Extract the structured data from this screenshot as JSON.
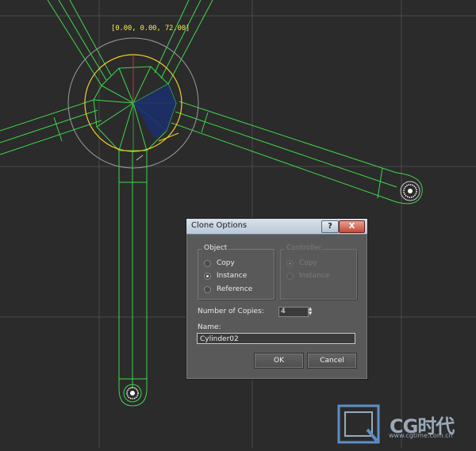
{
  "viewport": {
    "coord_readout": "[0.00, 0.00, 72.00]"
  },
  "dialog": {
    "title": "Clone Options",
    "help_label": "?",
    "close_label": "X",
    "object_group": {
      "legend": "Object",
      "options": [
        {
          "label": "Copy",
          "checked": false
        },
        {
          "label": "Instance",
          "checked": true
        },
        {
          "label": "Reference",
          "checked": false
        }
      ]
    },
    "controller_group": {
      "legend": "Controller",
      "options": [
        {
          "label": "Copy",
          "checked": true
        },
        {
          "label": "Instance",
          "checked": false
        }
      ]
    },
    "copies_label": "Number of Copies:",
    "copies_value": "4",
    "name_label": "Name:",
    "name_value": "Cylinder02",
    "ok_label": "OK",
    "cancel_label": "Cancel"
  },
  "watermark": {
    "brand": "CG时代",
    "url": "www.cgtime.com.cn"
  },
  "colors": {
    "wire": "#3fd64a",
    "gizmo_yellow": "#f5d020",
    "background": "#2b2b2b"
  }
}
